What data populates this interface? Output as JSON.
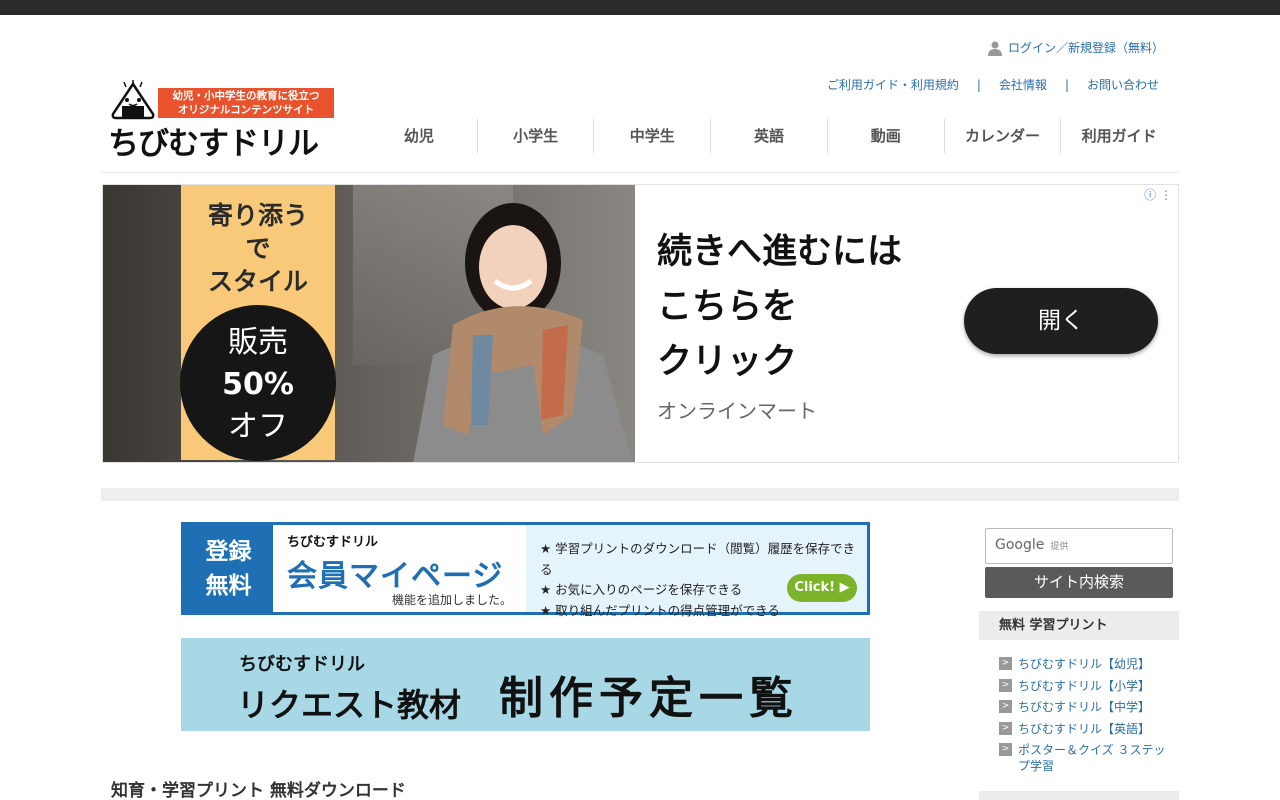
{
  "header": {
    "logo_badge_line1": "幼児・小中学生の教育に役立つ",
    "logo_badge_line2": "オリジナルコンテンツサイト",
    "logo_text": "ちびむすドリル",
    "login_label": "ログイン／新規登録（無料）",
    "util_links": [
      "ご利用ガイド・利用規約",
      "会社情報",
      "お問い合わせ"
    ],
    "nav": [
      "幼児",
      "小学生",
      "中学生",
      "英語",
      "動画",
      "カレンダー",
      "利用ガイド"
    ]
  },
  "ad": {
    "sign_text": [
      "寄り添う",
      "で",
      "スタイル"
    ],
    "circle_line1": "販売",
    "circle_line2": "50%",
    "circle_line3": "オフ",
    "copy": [
      "続きへ進むには",
      "こちらを",
      "クリック"
    ],
    "brand": "オンラインマート",
    "open_button": "開く",
    "info_icon": "ⓘ ⋮"
  },
  "banner_mypage": {
    "left": [
      "登録",
      "無料"
    ],
    "logo": "ちびむすドリル",
    "title": "会員マイページ",
    "sub": "機能を追加しました。",
    "features": [
      "★ 学習プリントのダウンロード（閲覧）履歴を保存できる",
      "★ お気に入りのページを保存できる",
      "★ 取り組んだプリントの得点管理ができる"
    ],
    "click_label": "Click! ▶"
  },
  "banner_request": {
    "logo": "ちびむすドリル",
    "left": "リクエスト教材",
    "right": "制作予定一覧"
  },
  "main": {
    "section_title": "知育・学習プリント 無料ダウンロード"
  },
  "sidebar": {
    "search_google": "Google",
    "search_provided": "提供",
    "search_button": "サイト内検索",
    "heading": "無料 学習プリント",
    "items": [
      "ちびむすドリル【幼児】",
      "ちびむすドリル【小学】",
      "ちびむすドリル【中学】",
      "ちびむすドリル【英語】",
      "ポスター＆クイズ ３ステップ学習"
    ]
  },
  "colors": {
    "link": "#2a6fa8",
    "accent_orange": "#e8532d",
    "mypage_blue": "#1e6fb3",
    "request_bg": "#a8d8e6",
    "click_green": "#7bb42a"
  }
}
